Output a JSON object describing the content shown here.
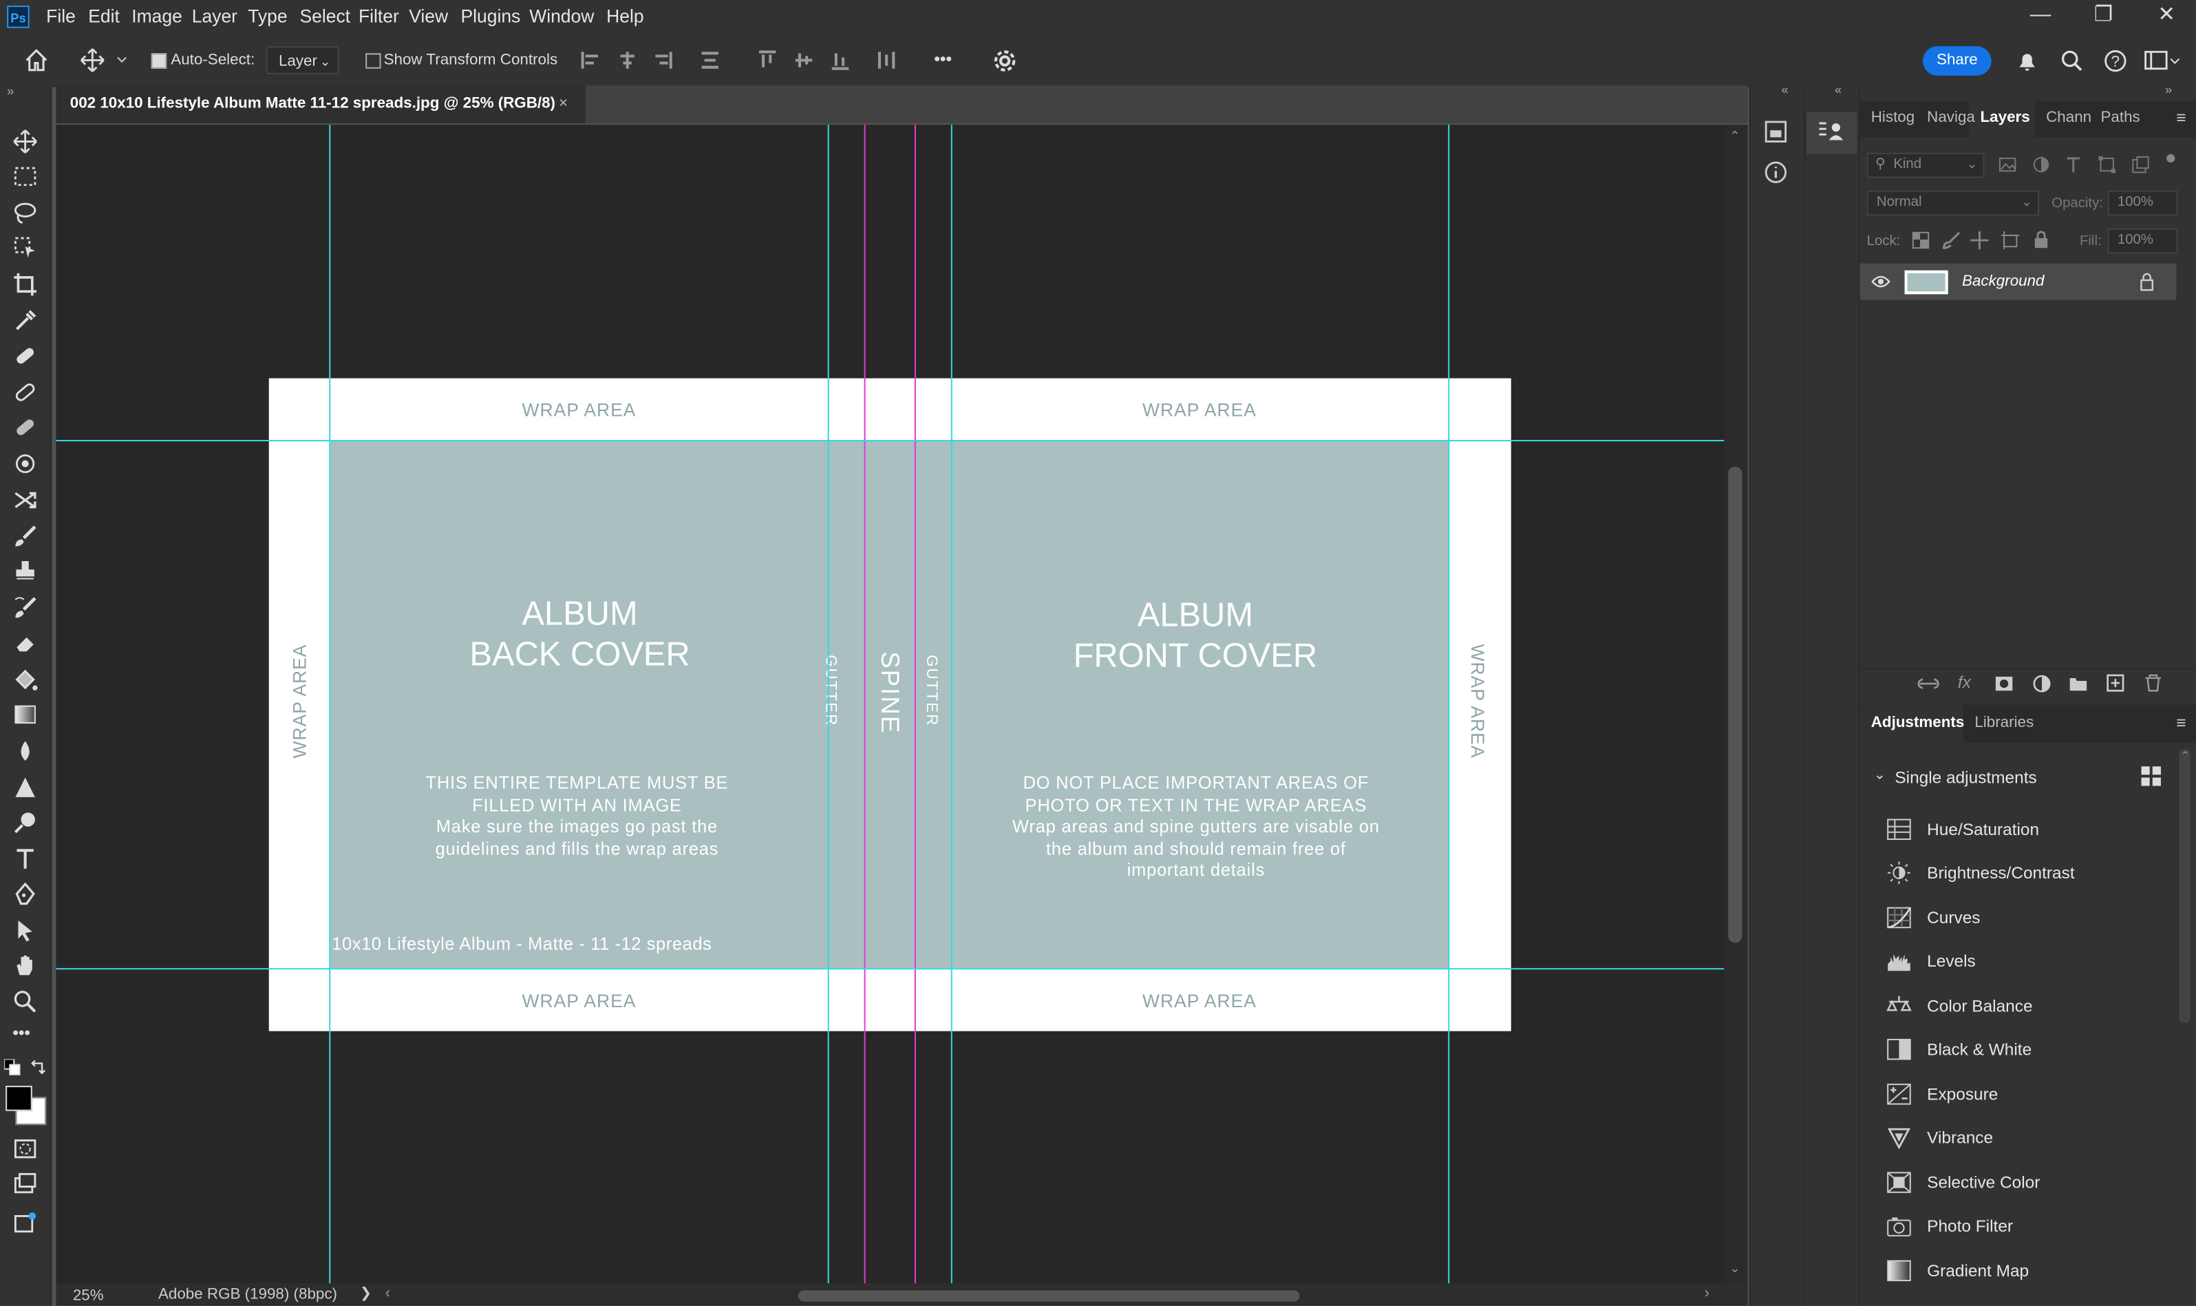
{
  "app": {
    "logo": "Ps"
  },
  "menu": [
    "File",
    "Edit",
    "Image",
    "Layer",
    "Type",
    "Select",
    "Filter",
    "View",
    "Plugins",
    "Window",
    "Help"
  ],
  "options_bar": {
    "auto_select_label": "Auto-Select:",
    "auto_select_checked": true,
    "auto_select_target": "Layer",
    "show_transform_label": "Show Transform Controls",
    "show_transform_checked": false,
    "more_label": "•••",
    "share_label": "Share"
  },
  "document_tab": {
    "title": "002 10x10 Lifestyle Album Matte 11-12 spreads.jpg @ 25% (RGB/8)",
    "close": "×"
  },
  "template": {
    "wrap_top_left": "WRAP AREA",
    "wrap_top_right": "WRAP AREA",
    "wrap_bottom_left": "WRAP AREA",
    "wrap_bottom_right": "WRAP AREA",
    "wrap_left": "WRAP AREA",
    "wrap_right": "WRAP AREA",
    "back_title_1": "ALBUM",
    "back_title_2": "BACK COVER",
    "front_title_1": "ALBUM",
    "front_title_2": "FRONT COVER",
    "gutter_left": "GUTTER",
    "gutter_right": "GUTTER",
    "spine": "SPINE",
    "back_note_1": "THIS ENTIRE TEMPLATE MUST BE",
    "back_note_2": "FILLED WITH AN IMAGE",
    "back_note_3": "Make sure the images go past the",
    "back_note_4": "guidelines and fills the wrap areas",
    "front_note_1": "DO NOT PLACE IMPORTANT AREAS OF",
    "front_note_2": "PHOTO OR TEXT IN THE WRAP AREAS",
    "front_note_3": "Wrap areas and spine gutters are visable on",
    "front_note_4": "the album and should remain free of",
    "front_note_5": "important details",
    "product_line": "10x10 Lifestyle Album - Matte - 11 -12 spreads"
  },
  "status_bar": {
    "zoom": "25%",
    "color_profile": "Adobe RGB (1998) (8bpc)",
    "arrow": "❯"
  },
  "layers_panel": {
    "tabs": [
      "Histog",
      "Naviga",
      "Layers",
      "Chann",
      "Paths"
    ],
    "active_tab": "Layers",
    "kind_placeholder": "Kind",
    "blend_mode": "Normal",
    "opacity_label": "Opacity:",
    "opacity_value": "100%",
    "lock_label": "Lock:",
    "fill_label": "Fill:",
    "fill_value": "100%",
    "layers": [
      {
        "name": "Background",
        "visible": true,
        "locked": true
      }
    ]
  },
  "adjustments_panel": {
    "tabs": [
      "Adjustments",
      "Libraries"
    ],
    "active_tab": "Adjustments",
    "section_title": "Single adjustments",
    "items": [
      "Hue/Saturation",
      "Brightness/Contrast",
      "Curves",
      "Levels",
      "Color Balance",
      "Black & White",
      "Exposure",
      "Vibrance",
      "Selective Color",
      "Photo Filter",
      "Gradient Map"
    ]
  },
  "colors": {
    "accent": "#1473e6",
    "guide_cyan": "#36d8e2",
    "guide_magenta": "#e23ad6",
    "template_fill": "#aabfbf",
    "wrap_text": "#8ea5a8"
  }
}
